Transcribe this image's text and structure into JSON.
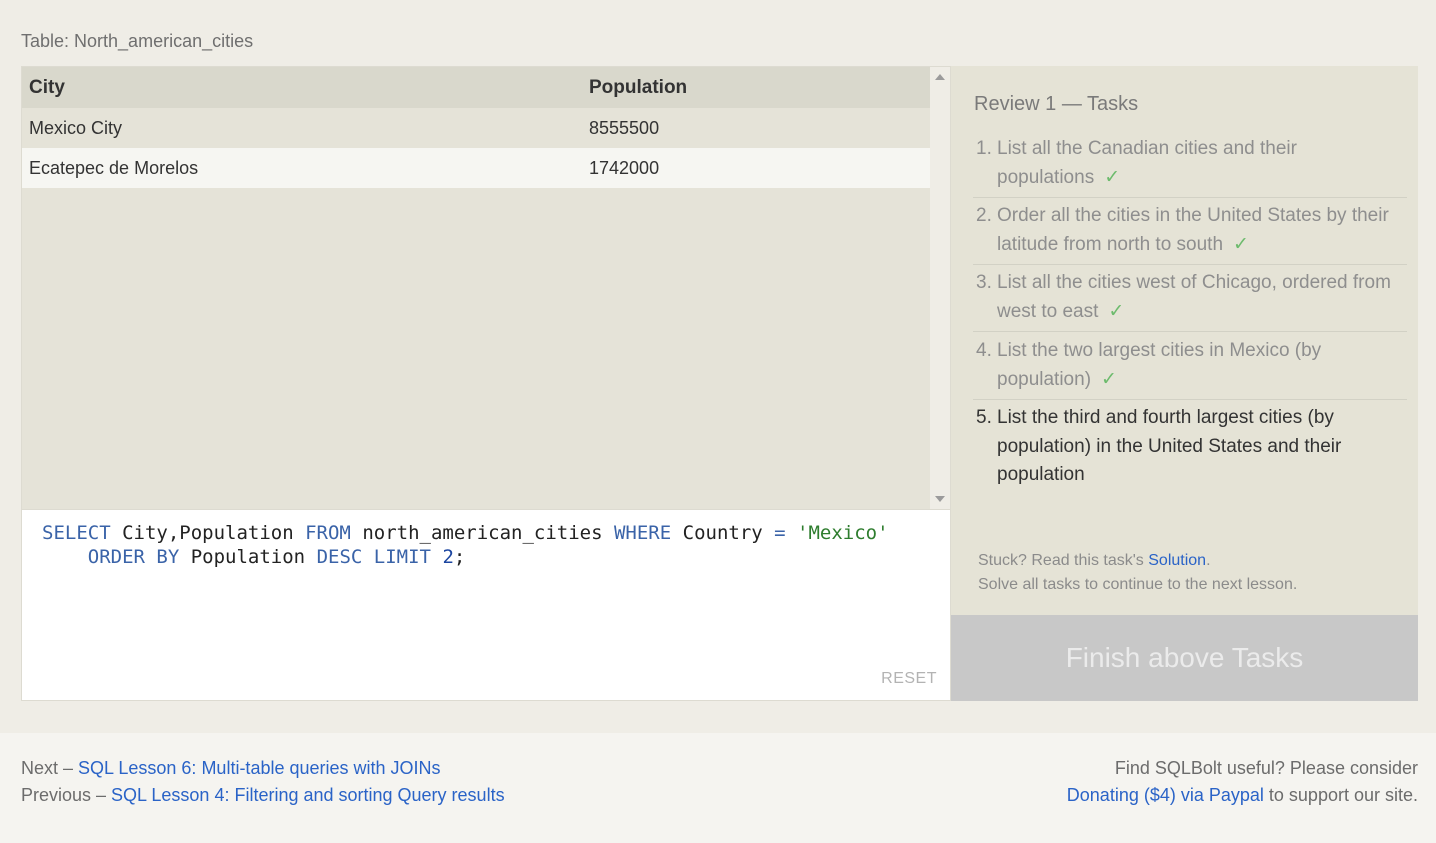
{
  "table_caption": "Table: North_american_cities",
  "results": {
    "columns": [
      "City",
      "Population"
    ],
    "rows": [
      [
        "Mexico City",
        "8555500"
      ],
      [
        "Ecatepec de Morelos",
        "1742000"
      ]
    ]
  },
  "editor": {
    "line1": {
      "kw_select": "SELECT",
      "cols": " City,Population ",
      "kw_from": "FROM",
      "table": " north_american_cities ",
      "kw_where": "WHERE",
      "cond": " Country ",
      "op": "=",
      "str": "'Mexico'"
    },
    "line2": {
      "kw_order": "ORDER BY",
      "col": " Population ",
      "kw_desc": "DESC",
      "kw_limit": "LIMIT",
      "num": "2",
      "end": ";"
    },
    "reset_label": "RESET"
  },
  "tasks": {
    "title": "Review 1 — Tasks",
    "items": [
      {
        "num": "1.",
        "text": "List all the Canadian cities and their populations",
        "done": true
      },
      {
        "num": "2.",
        "text": "Order all the cities in the United States by their latitude from north to south",
        "done": true
      },
      {
        "num": "3.",
        "text": "List all the cities west of Chicago, ordered from west to east",
        "done": true
      },
      {
        "num": "4.",
        "text": "List the two largest cities in Mexico (by population)",
        "done": true
      },
      {
        "num": "5.",
        "text": "List the third and fourth largest cities (by population) in the United States and their population",
        "done": false
      }
    ],
    "check_glyph": "✓",
    "stuck_prefix": "Stuck? Read this task's ",
    "solution_link": "Solution",
    "stuck_suffix": ".",
    "solve_all": "Solve all tasks to continue to the next lesson."
  },
  "finish_button": "Finish above Tasks",
  "footer": {
    "next_prefix": "Next – ",
    "next_link": "SQL Lesson 6: Multi-table queries with JOINs",
    "prev_prefix": "Previous – ",
    "prev_link": "SQL Lesson 4: Filtering and sorting Query results",
    "donate_line1": "Find SQLBolt useful? Please consider",
    "donate_link": "Donating ($4) via Paypal",
    "donate_suffix": " to support our site."
  },
  "colors": {
    "link": "#2a63c7",
    "keyword": "#3a63a8",
    "string": "#2e7d2e",
    "check": "#6dbb6d",
    "finish_bg": "#c8c8c8"
  }
}
